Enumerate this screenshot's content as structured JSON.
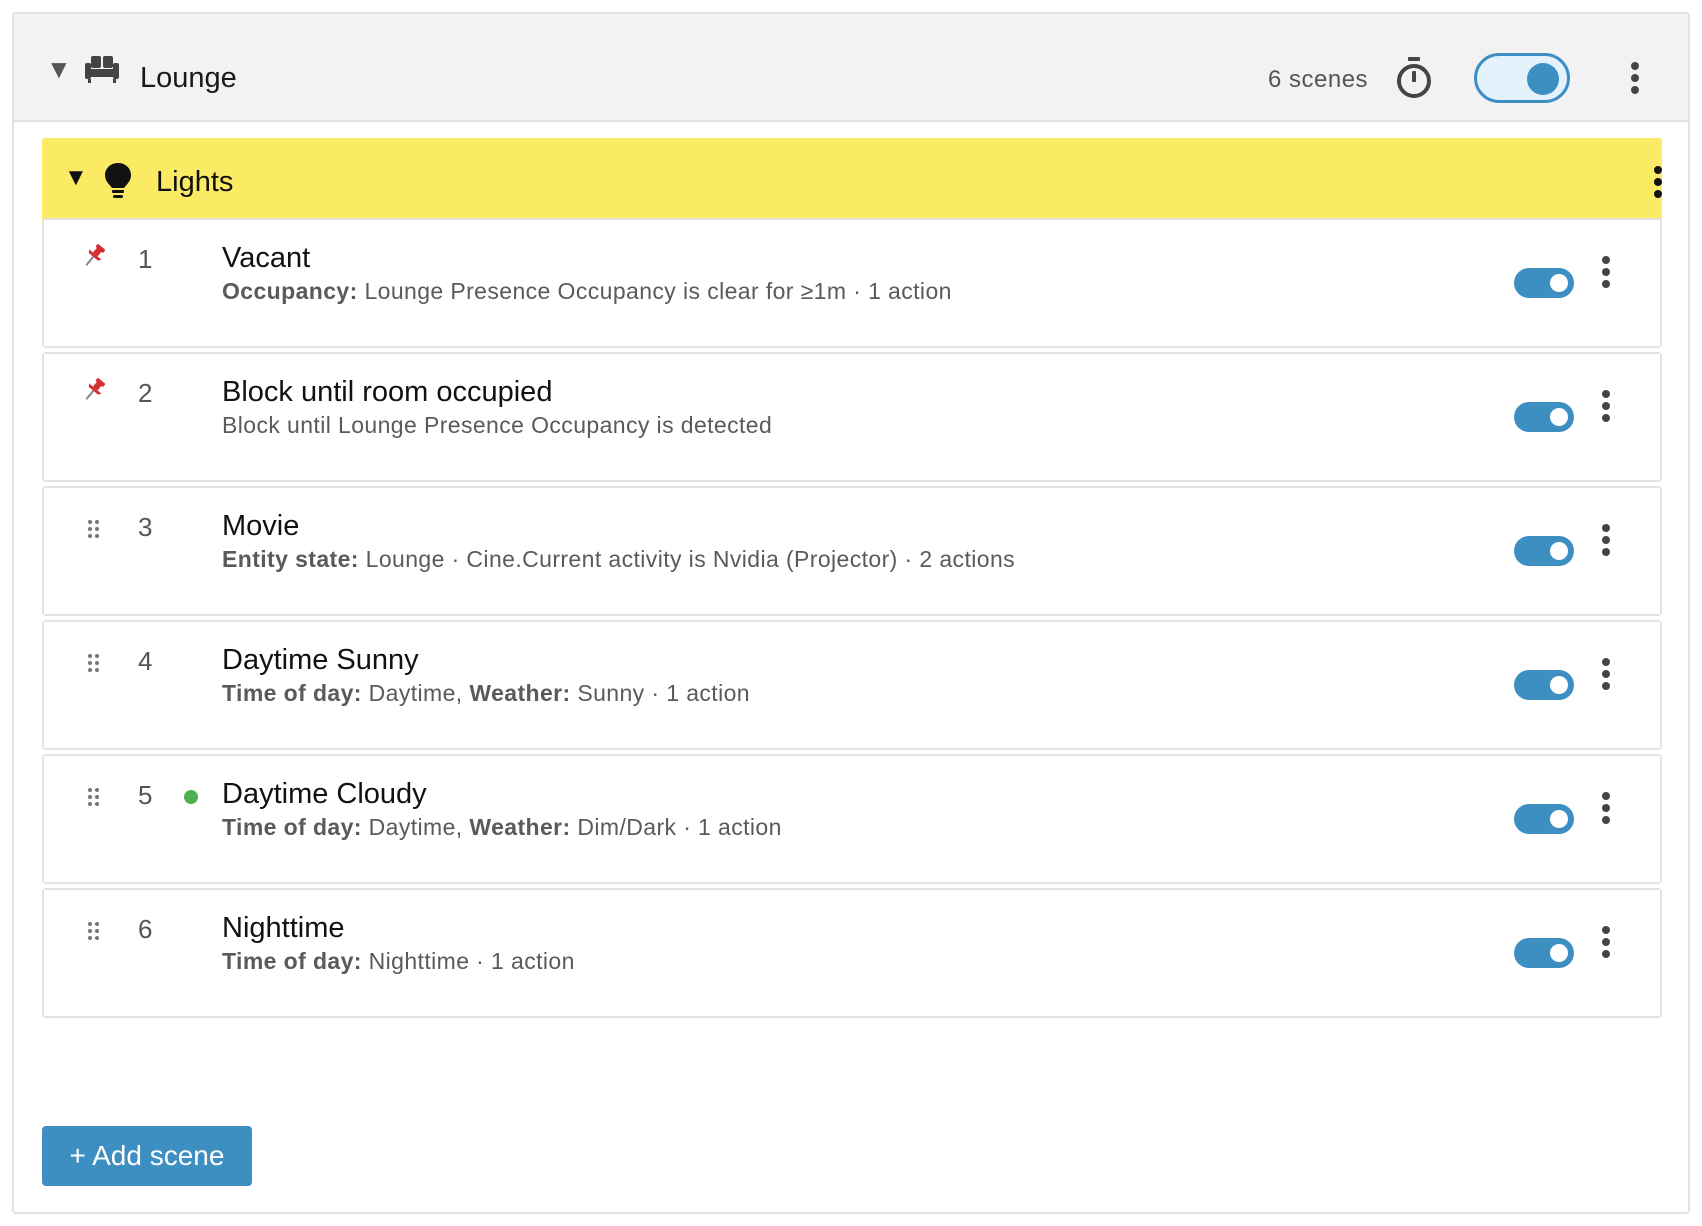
{
  "room": {
    "name": "Lounge",
    "icon": "sofa-icon",
    "scene_count": "6 scenes",
    "enabled": true
  },
  "group": {
    "name": "Lights",
    "icon": "lightbulb-icon",
    "color": "#fbea64"
  },
  "scenes": [
    {
      "number": "1",
      "name": "Vacant",
      "handle": "pin-icon",
      "active": false,
      "desc": [
        {
          "label": "Occupancy:",
          "text": " Lounge Presence Occupancy is clear for ≥1m · 1 action"
        }
      ]
    },
    {
      "number": "2",
      "name": "Block until room occupied",
      "handle": "pin-icon",
      "active": false,
      "desc": [
        {
          "label": "",
          "text": "Block until Lounge Presence Occupancy is detected"
        }
      ]
    },
    {
      "number": "3",
      "name": "Movie",
      "handle": "drag-handle-icon",
      "active": false,
      "desc": [
        {
          "label": "Entity state:",
          "text": " Lounge · Cine.Current activity is Nvidia (Projector) · 2 actions"
        }
      ]
    },
    {
      "number": "4",
      "name": "Daytime Sunny",
      "handle": "drag-handle-icon",
      "active": false,
      "desc": [
        {
          "label": "Time of day:",
          "text": " Daytime, "
        },
        {
          "label": "Weather:",
          "text": " Sunny · 1 action"
        }
      ]
    },
    {
      "number": "5",
      "name": "Daytime Cloudy",
      "handle": "drag-handle-icon",
      "active": true,
      "desc": [
        {
          "label": "Time of day:",
          "text": " Daytime, "
        },
        {
          "label": "Weather:",
          "text": " Dim/Dark · 1 action"
        }
      ]
    },
    {
      "number": "6",
      "name": "Nighttime",
      "handle": "drag-handle-icon",
      "active": false,
      "desc": [
        {
          "label": "Time of day:",
          "text": " Nighttime · 1 action"
        }
      ]
    }
  ],
  "add_scene_label": "+ Add scene",
  "colors": {
    "accent": "#3d8fc2",
    "active_indicator": "#4caf50",
    "pin": "#d32f2f"
  }
}
